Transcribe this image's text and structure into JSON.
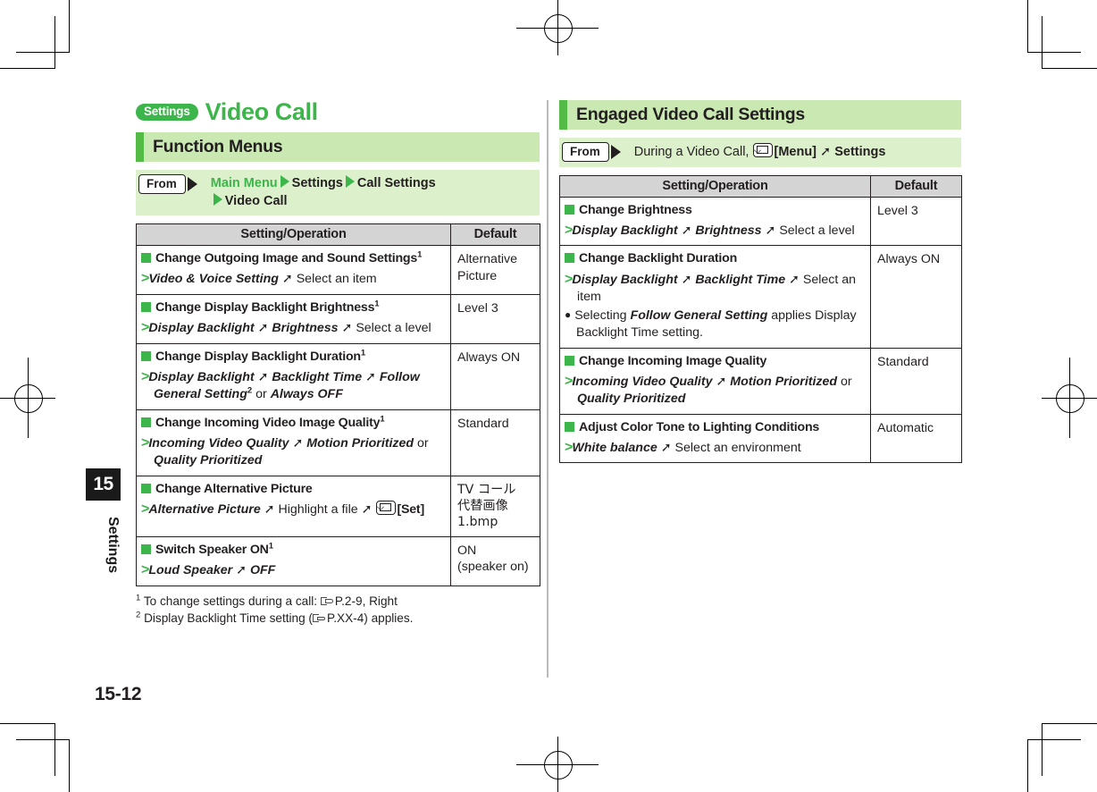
{
  "page": {
    "chapter_number": "15",
    "chapter_name": "Settings",
    "folio": "15-12"
  },
  "left": {
    "badge": "Settings",
    "title": "Video Call",
    "section_heading": "Function Menus",
    "from": {
      "label": "From",
      "line1_a": "Main Menu",
      "line1_b": "Settings",
      "line1_c": "Call Settings",
      "line2": "Video Call"
    },
    "table": {
      "headers": [
        "Setting/Operation",
        "Default"
      ],
      "rows": [
        {
          "heading": "Change Outgoing Image and Sound Settings",
          "heading_sup": "1",
          "path_bold": "Video & Voice Setting",
          "path_plain": "Select an item",
          "default": "Alternative Picture"
        },
        {
          "heading": "Change Display Backlight Brightness",
          "heading_sup": "1",
          "path_bold": "Display Backlight",
          "path_bold2": "Brightness",
          "path_plain": "Select a level",
          "default": "Level 3"
        },
        {
          "heading": "Change Display Backlight Duration",
          "heading_sup": "1",
          "path_bold": "Display Backlight",
          "path_bold2": "Backlight Time",
          "path_bold3": "Follow General Setting",
          "path_bold3_sup": "2",
          "path_or": "or",
          "path_bold4": "Always OFF",
          "default": "Always ON"
        },
        {
          "heading": "Change Incoming Video Image Quality",
          "heading_sup": "1",
          "path_bold": "Incoming Video Quality",
          "path_bold2": "Motion Prioritized",
          "path_or": "or",
          "path_bold3": "Quality Prioritized",
          "default": "Standard"
        },
        {
          "heading": "Change Alternative Picture",
          "heading_sup": "",
          "path_bold": "Alternative Picture",
          "path_plain": "Highlight a file",
          "path_key": "[Set]",
          "default_jp1": "TV コール",
          "default_jp2": "代替画像",
          "default_jp3": "1.bmp"
        },
        {
          "heading": "Switch Speaker ON",
          "heading_sup": "1",
          "path_bold": "Loud Speaker",
          "path_bold2": "OFF",
          "default_l1": "ON",
          "default_l2": "(speaker on)"
        }
      ]
    },
    "footnotes": [
      {
        "marker": "1",
        "text_a": "To change settings during a call:",
        "ref": "P.2-9, Right"
      },
      {
        "marker": "2",
        "text_a": "Display Backlight Time setting (",
        "ref": "P.XX-4",
        "text_b": ") applies."
      }
    ]
  },
  "right": {
    "section_heading": "Engaged Video Call Settings",
    "from": {
      "label": "From",
      "text_a": "During a Video Call,",
      "key": "[Menu]",
      "text_b": "Settings"
    },
    "table": {
      "headers": [
        "Setting/Operation",
        "Default"
      ],
      "rows": [
        {
          "heading": "Change Brightness",
          "path_bold": "Display Backlight",
          "path_bold2": "Brightness",
          "path_plain": "Select a level",
          "default": "Level 3"
        },
        {
          "heading": "Change Backlight Duration",
          "path_bold": "Display Backlight",
          "path_bold2": "Backlight Time",
          "path_plain": "Select an item",
          "note_a": "Selecting",
          "note_bold": "Follow General Setting",
          "note_b": "applies Display Backlight Time setting.",
          "default": "Always ON"
        },
        {
          "heading": "Change Incoming Image Quality",
          "path_bold": "Incoming Video Quality",
          "path_bold2": "Motion Prioritized",
          "path_or": "or",
          "path_bold3": "Quality Prioritized",
          "default": "Standard"
        },
        {
          "heading": "Adjust Color Tone to Lighting Conditions",
          "path_bold": "White balance",
          "path_plain": "Select an environment",
          "default": "Automatic"
        }
      ]
    }
  },
  "colors": {
    "green_accent": "#3cb54a",
    "green_bar": "#54bb46",
    "green_head_bg": "#c9e8b2",
    "green_from_bg": "#ddf0cc",
    "table_header_bg": "#d4d4d4",
    "ink": "#231f20"
  }
}
